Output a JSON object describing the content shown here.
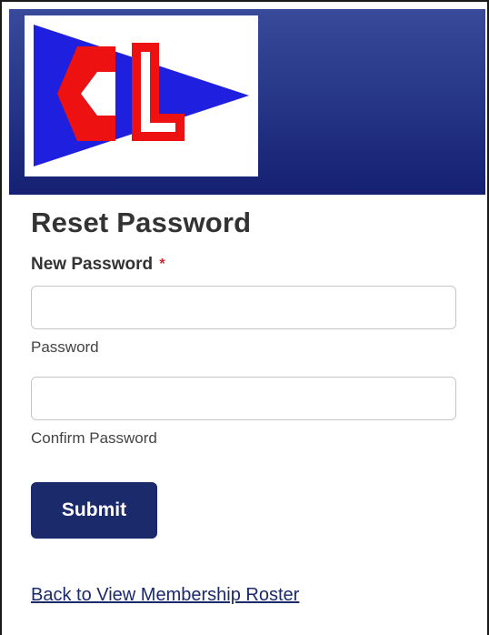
{
  "branding": {
    "logo_letters": "CL",
    "colors": {
      "header_top": "#3a4a9a",
      "header_bottom": "#152072",
      "flag_blue": "#1f1fe0",
      "flag_red": "#ee1111"
    }
  },
  "form": {
    "title": "Reset Password",
    "new_password_label": "New Password",
    "required_marker": "*",
    "password_value": "",
    "password_helper": "Password",
    "confirm_value": "",
    "confirm_helper": "Confirm Password",
    "submit_label": "Submit",
    "accent_color": "#1b2a6b"
  },
  "footer": {
    "back_link": "Back to View Membership Roster"
  }
}
